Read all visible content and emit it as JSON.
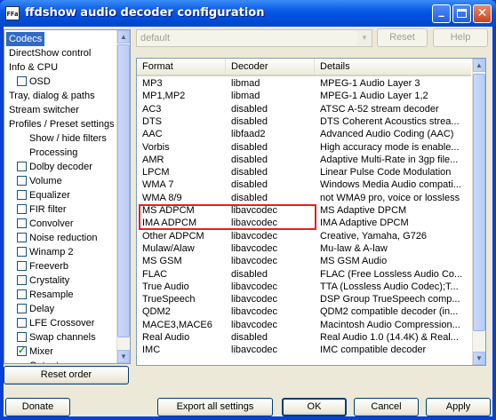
{
  "window": {
    "title": "ffdshow audio decoder configuration",
    "icon_text": "FFa",
    "minimize_glyph": "_",
    "close_glyph": "✕"
  },
  "tree": {
    "items": [
      {
        "label": "Codecs",
        "indent": 0,
        "checkbox": false,
        "selected": true
      },
      {
        "label": "DirectShow control",
        "indent": 0,
        "checkbox": false
      },
      {
        "label": "Info & CPU",
        "indent": 0,
        "checkbox": false
      },
      {
        "label": "OSD",
        "indent": 1,
        "checkbox": true,
        "checked": false
      },
      {
        "label": "Tray, dialog & paths",
        "indent": 0,
        "checkbox": false
      },
      {
        "label": "Stream switcher",
        "indent": 0,
        "checkbox": false
      },
      {
        "label": "Profiles / Preset settings",
        "indent": 0,
        "checkbox": false
      },
      {
        "label": "Show / hide filters",
        "indent": 2,
        "checkbox": false
      },
      {
        "label": "Processing",
        "indent": 2,
        "checkbox": false
      },
      {
        "label": "Dolby decoder",
        "indent": 1,
        "checkbox": true,
        "checked": false
      },
      {
        "label": "Volume",
        "indent": 1,
        "checkbox": true,
        "checked": false
      },
      {
        "label": "Equalizer",
        "indent": 1,
        "checkbox": true,
        "checked": false
      },
      {
        "label": "FIR filter",
        "indent": 1,
        "checkbox": true,
        "checked": false
      },
      {
        "label": "Convolver",
        "indent": 1,
        "checkbox": true,
        "checked": false
      },
      {
        "label": "Noise reduction",
        "indent": 1,
        "checkbox": true,
        "checked": false
      },
      {
        "label": "Winamp 2",
        "indent": 1,
        "checkbox": true,
        "checked": false
      },
      {
        "label": "Freeverb",
        "indent": 1,
        "checkbox": true,
        "checked": false
      },
      {
        "label": "Crystality",
        "indent": 1,
        "checkbox": true,
        "checked": false
      },
      {
        "label": "Resample",
        "indent": 1,
        "checkbox": true,
        "checked": false
      },
      {
        "label": "Delay",
        "indent": 1,
        "checkbox": true,
        "checked": false
      },
      {
        "label": "LFE Crossover",
        "indent": 1,
        "checkbox": true,
        "checked": false
      },
      {
        "label": "Swap channels",
        "indent": 1,
        "checkbox": true,
        "checked": false
      },
      {
        "label": "Mixer",
        "indent": 1,
        "checkbox": true,
        "checked": true
      },
      {
        "label": "Output",
        "indent": 2,
        "checkbox": false
      }
    ]
  },
  "preset": {
    "value": "default",
    "reset_label": "Reset",
    "help_label": "Help"
  },
  "list": {
    "columns": [
      "Format",
      "Decoder",
      "Details"
    ],
    "rows": [
      [
        "MP3",
        "libmad",
        "MPEG-1 Audio Layer 3"
      ],
      [
        "MP1,MP2",
        "libmad",
        "MPEG-1 Audio Layer 1,2"
      ],
      [
        "AC3",
        "disabled",
        "ATSC A-52 stream decoder"
      ],
      [
        "DTS",
        "disabled",
        "DTS Coherent Acoustics strea..."
      ],
      [
        "AAC",
        "libfaad2",
        "Advanced Audio Coding (AAC)"
      ],
      [
        "Vorbis",
        "disabled",
        "High accuracy mode is enable..."
      ],
      [
        "AMR",
        "disabled",
        "Adaptive Multi-Rate in 3gp file..."
      ],
      [
        "LPCM",
        "disabled",
        "Linear Pulse Code Modulation"
      ],
      [
        "WMA 7",
        "disabled",
        "Windows Media Audio compati..."
      ],
      [
        "WMA 8/9",
        "disabled",
        "not WMA9 pro, voice or lossless"
      ],
      [
        "MS ADPCM",
        "libavcodec",
        "MS Adaptive DPCM"
      ],
      [
        "IMA ADPCM",
        "libavcodec",
        "IMA Adaptive DPCM"
      ],
      [
        "Other ADPCM",
        "libavcodec",
        "Creative, Yamaha, G726"
      ],
      [
        "Mulaw/Alaw",
        "libavcodec",
        "Mu-law & A-law"
      ],
      [
        "MS GSM",
        "libavcodec",
        "MS GSM Audio"
      ],
      [
        "FLAC",
        "disabled",
        "FLAC (Free Lossless Audio Co..."
      ],
      [
        "True Audio",
        "libavcodec",
        "TTA (Lossless Audio Codec);T..."
      ],
      [
        "TrueSpeech",
        "libavcodec",
        "DSP Group TrueSpeech comp..."
      ],
      [
        "QDM2",
        "libavcodec",
        "QDM2 compatible decoder (in..."
      ],
      [
        "MACE3,MACE6",
        "libavcodec",
        "Macintosh Audio Compression..."
      ],
      [
        "Real Audio",
        "disabled",
        "Real Audio 1.0 (14.4K) & Real..."
      ],
      [
        "IMC",
        "libavcodec",
        "IMC compatible decoder"
      ]
    ]
  },
  "buttons": {
    "reset_order": "Reset order",
    "donate": "Donate",
    "export": "Export all settings",
    "ok": "OK",
    "cancel": "Cancel",
    "apply": "Apply"
  },
  "colors": {
    "selection": "#316ac5",
    "highlight_outline": "#e8201c",
    "titlebar": "#0050e0"
  }
}
